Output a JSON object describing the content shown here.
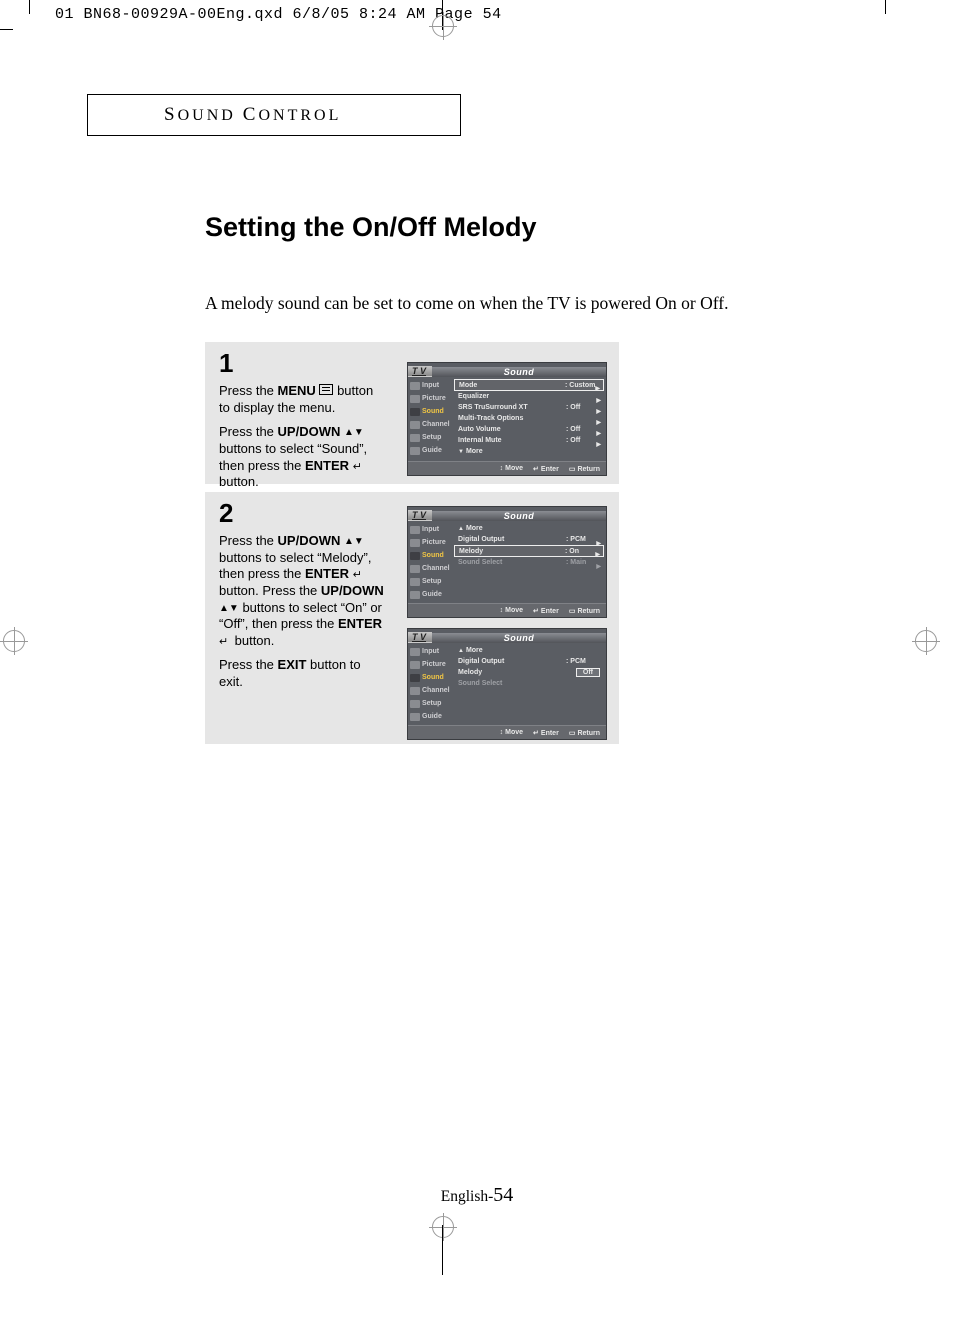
{
  "header_line": "01 BN68-00929A-00Eng.qxd  6/8/05 8:24 AM  Page 54",
  "section_title_pre1": "S",
  "section_title_word1": "OUND",
  "section_title_pre2": "C",
  "section_title_word2": "ONTROL",
  "page_title": "Setting the On/Off Melody",
  "intro": "A melody sound can be set to come on when the TV is powered On or Off.",
  "step1": {
    "num": "1",
    "p1a": "Press the ",
    "p1b": "MENU",
    "p1c": " button to display the menu.",
    "p2a": "Press the ",
    "p2b": "UP/DOWN",
    "p2c": " buttons to select “Sound”, then press the ",
    "p2d": "ENTER",
    "p2e": " button."
  },
  "step2": {
    "num": "2",
    "p1a": "Press the ",
    "p1b": "UP/DOWN",
    "p1c": " buttons to select “Melody”, then press the ",
    "p1d": "ENTER",
    "p1e": " button. Press the ",
    "p1f": "UP/DOWN",
    "p1g": " buttons to select “On” or “Off”, then press the ",
    "p1h": "ENTER",
    "p1i": " button.",
    "p2a": "Press the ",
    "p2b": "EXIT",
    "p2c": " button to exit."
  },
  "osd_common": {
    "tv": "T V",
    "title": "Sound",
    "sidebar": [
      "Input",
      "Picture",
      "Sound",
      "Channel",
      "Setup",
      "Guide"
    ],
    "foot_move": "Move",
    "foot_enter": "Enter",
    "foot_return": "Return",
    "more": "More"
  },
  "osd1": {
    "rows": [
      {
        "label": "Mode",
        "value": ": Custom",
        "hl": true,
        "arrow": true
      },
      {
        "label": "Equalizer",
        "value": "",
        "arrow": true
      },
      {
        "label": "SRS TruSurround XT",
        "value": ": Off",
        "arrow": true
      },
      {
        "label": "Multi-Track Options",
        "value": "",
        "arrow": true
      },
      {
        "label": "Auto Volume",
        "value": ": Off",
        "arrow": true
      },
      {
        "label": "Internal Mute",
        "value": ": Off",
        "arrow": true
      }
    ]
  },
  "osd2": {
    "rows": [
      {
        "label": "Digital Output",
        "value": ": PCM",
        "arrow": true
      },
      {
        "label": "Melody",
        "value": ": On",
        "hl": true,
        "arrow": true
      },
      {
        "label": "Sound Select",
        "value": ": Main",
        "dim": true,
        "arrow": true
      }
    ]
  },
  "osd3": {
    "rows": [
      {
        "label": "Digital Output",
        "value": ": PCM"
      },
      {
        "label": "Melody",
        "value": "",
        "valbox": "Off"
      },
      {
        "label": "Sound Select",
        "value": "",
        "dim": true
      }
    ]
  },
  "footer_lang": "English-",
  "footer_page": "54"
}
